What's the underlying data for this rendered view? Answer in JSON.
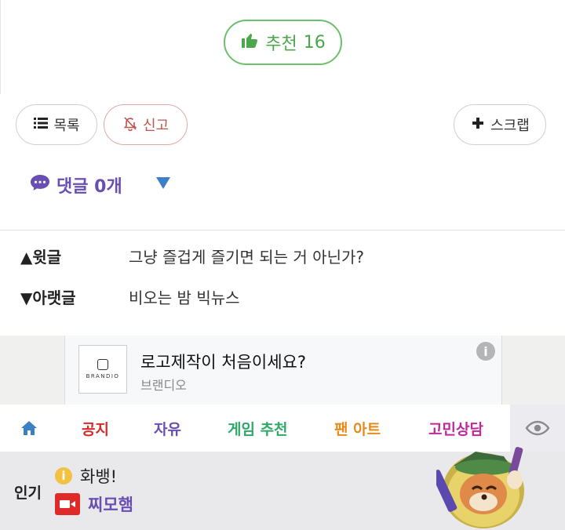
{
  "recommend": {
    "label": "추천",
    "count": "16"
  },
  "actions": {
    "list_label": "목록",
    "report_label": "신고",
    "scrap_label": "스크랩"
  },
  "comments": {
    "label": "댓글 0개"
  },
  "post_nav": {
    "prev_label": "▲윗글",
    "prev_title": "그냥 즐겁게 즐기면 되는 거 아닌가?",
    "next_label": "▼아랫글",
    "next_title": "비오는 밤 빅뉴스"
  },
  "ad": {
    "logo_text": "BRANDIO",
    "title": "로고제작이 처음이세요?",
    "subtitle": "브랜디오",
    "info": "i"
  },
  "categories": [
    {
      "label": "공지",
      "color": "#d62a2a"
    },
    {
      "label": "자유",
      "color": "#6a4fb3"
    },
    {
      "label": "게임 추천",
      "color": "#2fa86a"
    },
    {
      "label": "팬 아트",
      "color": "#e88a1a"
    },
    {
      "label": "고민상담",
      "color": "#c0289a"
    }
  ],
  "popular": {
    "label": "인기",
    "items": [
      {
        "text": "화뱅!",
        "icon": "info-icon"
      },
      {
        "text": "찌모햄",
        "icon": "video-icon"
      }
    ]
  },
  "colors": {
    "accent": "#6a4fb3",
    "recommend": "#4aa84a",
    "report": "#c0524c"
  }
}
